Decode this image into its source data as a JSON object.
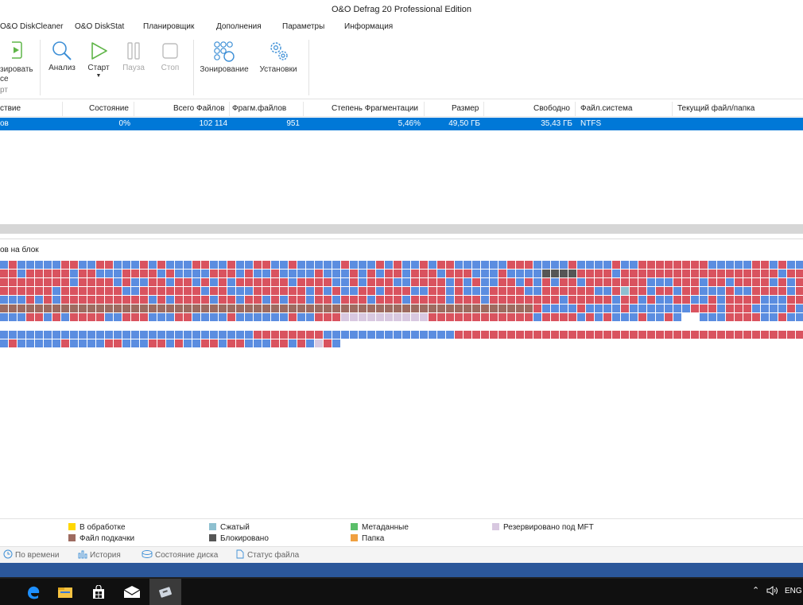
{
  "window": {
    "title": "O&O Defrag 20 Professional Edition"
  },
  "menu": [
    "O&O DiskCleaner",
    "O&O DiskStat",
    "Планировщик",
    "Дополнения",
    "Параметры",
    "Информация"
  ],
  "ribbon": {
    "partial_labels": [
      "зировать",
      "се",
      "рт"
    ],
    "buttons": [
      {
        "id": "analyze",
        "label": "Анализ"
      },
      {
        "id": "start",
        "label": "Старт"
      },
      {
        "id": "pause",
        "label": "Пауза"
      },
      {
        "id": "stop",
        "label": "Стоп"
      },
      {
        "id": "zoning",
        "label": "Зонирование"
      },
      {
        "id": "settings",
        "label": "Установки"
      }
    ]
  },
  "table": {
    "headers": [
      "ствие",
      "Состояние",
      "Всего Файлов",
      "Фрагм.файлов",
      "Степень Фрагментации",
      "Размер",
      "Свободно",
      "Файл.система",
      "Текущий файл/папка"
    ],
    "rows": [
      {
        "action": "ов",
        "state": "0%",
        "total_files": "102 114",
        "frag_files": "951",
        "frag_degree": "5,46%",
        "size": "49,50 ГБ",
        "free": "35,43 ГБ",
        "fs": "NTFS",
        "current": ""
      }
    ]
  },
  "cluster_map": {
    "title": "ов на блок",
    "colors": {
      "fragmented": "#d9535f",
      "contiguous": "#5b8de0",
      "pagefile": "#9e6b60",
      "blocked": "#565656",
      "compressed": "#8ec0d0",
      "mft_reserved": "#d8c8e0",
      "free": "#ffffff"
    }
  },
  "legend": [
    {
      "label": "В обработке",
      "color": "#ffd700"
    },
    {
      "label": "Файл подкачки",
      "color": "#9e6b60"
    },
    {
      "label": "Сжатый",
      "color": "#8ec0d0"
    },
    {
      "label": "Блокировано",
      "color": "#565656"
    },
    {
      "label": "Метаданные",
      "color": "#5bbf6a"
    },
    {
      "label": "Папка",
      "color": "#f0a040"
    },
    {
      "label": "Резервировано под MFT",
      "color": "#d8c8e0"
    }
  ],
  "bottom_tabs": [
    "По времени",
    "История",
    "Состояние диска",
    "Статус файла"
  ],
  "taskbar": {
    "lang": "ENG"
  }
}
